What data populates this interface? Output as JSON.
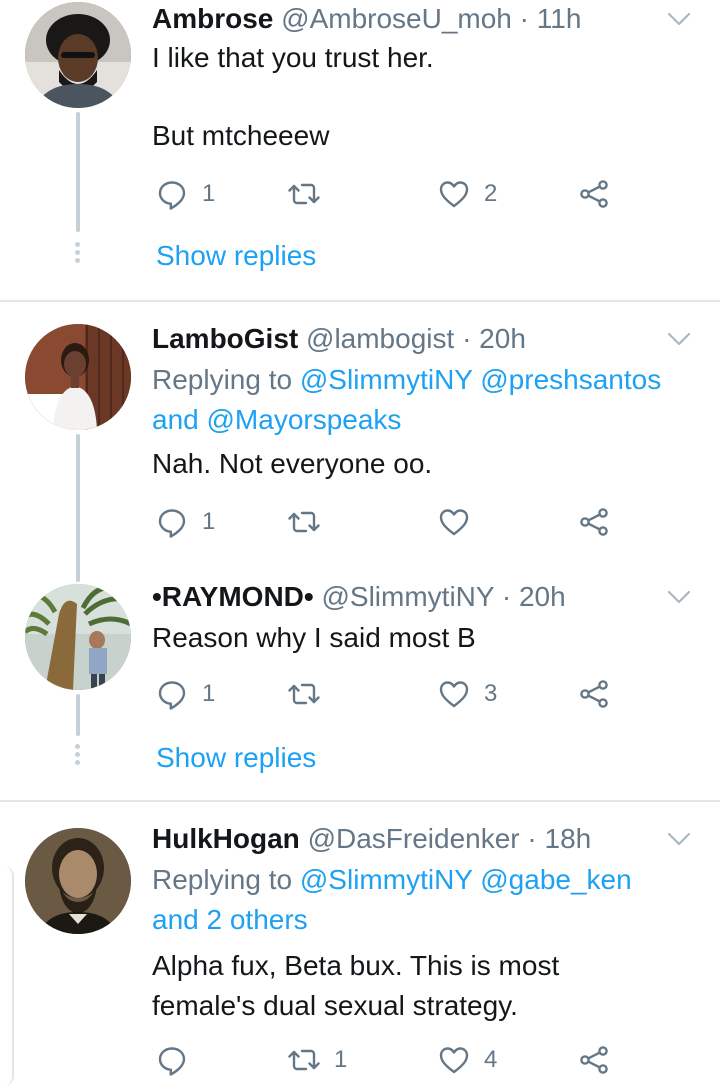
{
  "tweets": [
    {
      "name": "Ambrose",
      "handle": "@AmbroseU_moh",
      "time": "11h",
      "replying_prefix": "",
      "replying": [],
      "text_lines": [
        "I like that you trust her.",
        "",
        "But mtcheeew"
      ],
      "counts": {
        "reply": "1",
        "retweet": "",
        "like": "2"
      },
      "show_replies": "Show replies"
    },
    {
      "name": "LamboGist",
      "handle": "@lambogist",
      "time": "20h",
      "replying_prefix": "Replying to",
      "replying": [
        "@SlimmytiNY",
        "@preshsantos",
        "and",
        "@Mayorspeaks"
      ],
      "text_lines": [
        "Nah. Not everyone oo."
      ],
      "counts": {
        "reply": "1",
        "retweet": "",
        "like": ""
      }
    },
    {
      "name": "•RAYMOND•",
      "handle": "@SlimmytiNY",
      "time": "20h",
      "text_lines": [
        "Reason why I said most B"
      ],
      "counts": {
        "reply": "1",
        "retweet": "",
        "like": "3"
      },
      "show_replies": "Show replies"
    },
    {
      "name": "HulkHogan",
      "handle": "@DasFreidenker",
      "time": "18h",
      "replying_prefix": "Replying to",
      "replying": [
        "@SlimmytiNY",
        "@gabe_ken",
        "and 2 others"
      ],
      "text_lines": [
        "Alpha fux, Beta bux. This is most",
        "female's dual sexual strategy."
      ],
      "counts": {
        "reply": "",
        "retweet": "1",
        "like": "4"
      }
    }
  ],
  "colors": {
    "accent": "#1da1f2",
    "secondary_text": "#657786",
    "thread_line": "#c4cfd6",
    "divider": "#e1e8ed"
  },
  "icons": [
    "reply-icon",
    "retweet-icon",
    "like-icon",
    "share-icon",
    "chevron-down-icon"
  ]
}
